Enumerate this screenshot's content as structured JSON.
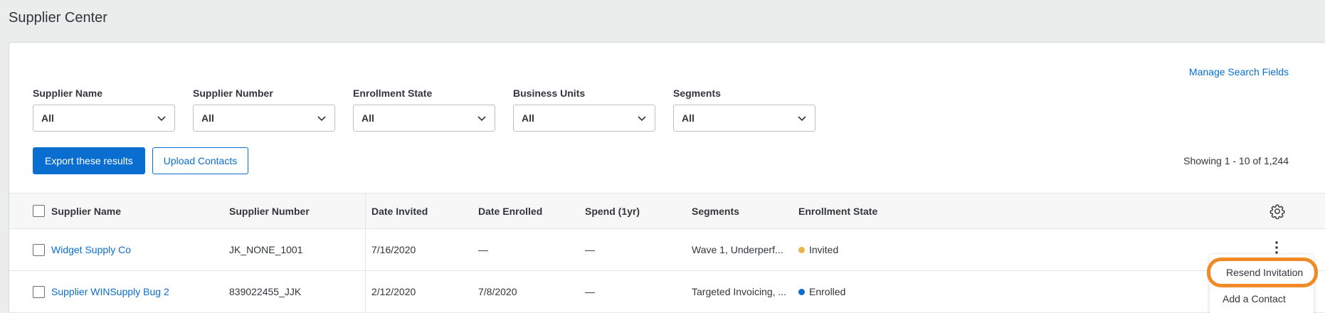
{
  "page": {
    "title": "Supplier Center"
  },
  "search": {
    "manage_link": "Manage Search Fields"
  },
  "filters": [
    {
      "label": "Supplier Name",
      "value": "All"
    },
    {
      "label": "Supplier Number",
      "value": "All"
    },
    {
      "label": "Enrollment State",
      "value": "All"
    },
    {
      "label": "Business Units",
      "value": "All"
    },
    {
      "label": "Segments",
      "value": "All"
    }
  ],
  "actions": {
    "export_label": "Export these results",
    "upload_label": "Upload Contacts"
  },
  "results": {
    "showing": "Showing 1 - 10 of 1,244"
  },
  "table": {
    "headers": {
      "name": "Supplier Name",
      "number": "Supplier Number",
      "invited": "Date Invited",
      "enrolled": "Date Enrolled",
      "spend": "Spend (1yr)",
      "segments": "Segments",
      "state": "Enrollment State"
    },
    "rows": [
      {
        "name": "Widget Supply Co",
        "number": "JK_NONE_1001",
        "invited": "7/16/2020",
        "enrolled": "—",
        "spend": "—",
        "segments": "Wave 1, Underperf...",
        "state": "Invited",
        "state_color": "#e9b44c"
      },
      {
        "name": "Supplier WINSupply Bug 2",
        "number": "839022455_JJK",
        "invited": "2/12/2020",
        "enrolled": "7/8/2020",
        "spend": "—",
        "segments": "Targeted Invoicing, ...",
        "state": "Enrolled",
        "state_color": "#0a6ed1"
      }
    ]
  },
  "row_menu": {
    "items": [
      "Resend Invitation",
      "Add a Contact"
    ],
    "highlight_color": "#f08a24"
  },
  "icons": {
    "settings": "gear-icon",
    "row_actions": "more-vertical-icon",
    "dropdown": "chevron-down-icon"
  },
  "colors": {
    "accent": "#0a6ed1",
    "background": "#ebeded"
  }
}
